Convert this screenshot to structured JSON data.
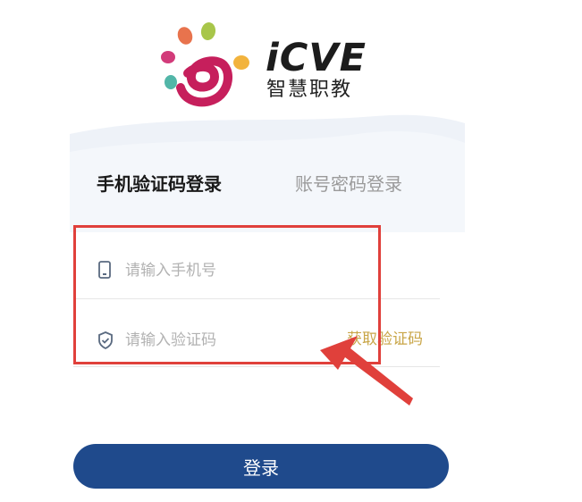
{
  "brand": {
    "name_en": "iCVE",
    "name_cn": "智慧职教"
  },
  "tabs": {
    "sms_login": "手机验证码登录",
    "password_login": "账号密码登录"
  },
  "form": {
    "phone_placeholder": "请输入手机号",
    "code_placeholder": "请输入验证码",
    "get_code_label": "获取验证码"
  },
  "login_button": "登录",
  "icons": {
    "logo": "icve-logo-icon",
    "phone": "phone-icon",
    "shield": "shield-check-icon",
    "arrow": "red-arrow-annotation"
  },
  "colors": {
    "primary": "#1f4a8c",
    "get_code": "#c9a648",
    "annotation": "#e0403b",
    "tab_active": "#1a1a1a",
    "tab_inactive": "#9a9a9a"
  }
}
